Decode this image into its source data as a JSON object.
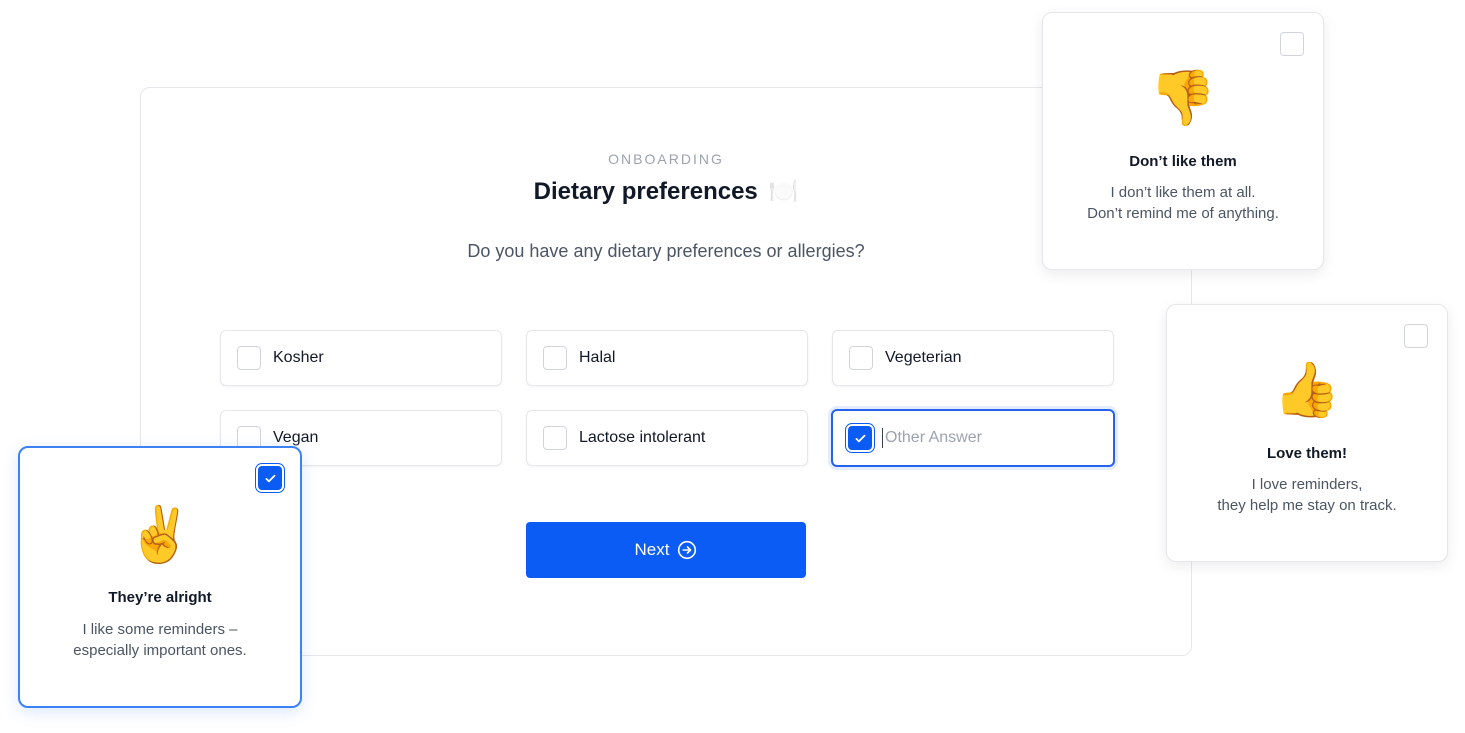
{
  "onboarding": {
    "eyebrow": "ONBOARDING",
    "title": "Dietary preferences",
    "title_emoji": "🍽️",
    "question": "Do you have any dietary preferences or allergies?",
    "options": [
      {
        "label": "Kosher",
        "checked": false
      },
      {
        "label": "Halal",
        "checked": false
      },
      {
        "label": "Vegeterian",
        "checked": false
      },
      {
        "label": "Vegan",
        "checked": false
      },
      {
        "label": "Lactose intolerant",
        "checked": false
      }
    ],
    "other": {
      "placeholder": "Other Answer",
      "value": "",
      "checked": true
    },
    "next_label": "Next",
    "accent_color": "#0a5cf5"
  },
  "feelings": [
    {
      "emoji": "👎",
      "title": "Don’t like them",
      "line1": "I don’t like them at all.",
      "line2": "Don’t remind me of anything.",
      "checked": false
    },
    {
      "emoji": "👍",
      "title": "Love them!",
      "line1": "I love reminders,",
      "line2": "they help me stay on track.",
      "checked": false
    },
    {
      "emoji": "✌️",
      "title": "They’re alright",
      "line1": "I like some reminders –",
      "line2": "especially important ones.",
      "checked": true
    }
  ]
}
